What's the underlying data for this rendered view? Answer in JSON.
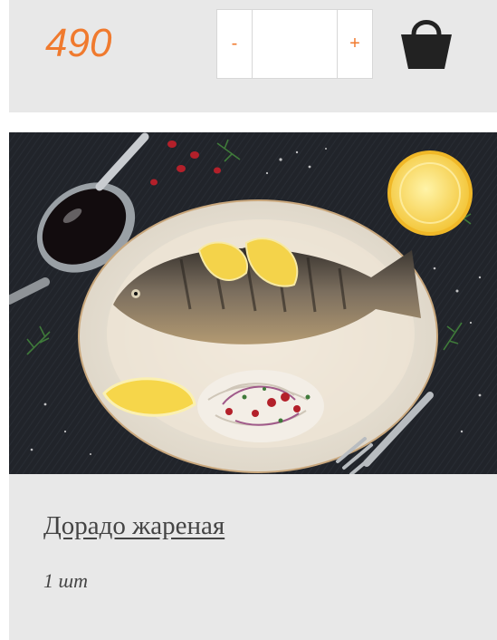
{
  "product": {
    "price": "490",
    "name": "Дорадо жареная",
    "unit": "1 шт"
  },
  "quantity": {
    "minus_label": "-",
    "plus_label": "+",
    "value": ""
  },
  "cart": {
    "icon": "shopping-bag-icon"
  },
  "image": {
    "subject": "grilled-dorado-plate"
  },
  "colors": {
    "accent": "#f07a2e",
    "card_bg": "#e8e8e8",
    "icon": "#222222",
    "text": "#444444"
  }
}
